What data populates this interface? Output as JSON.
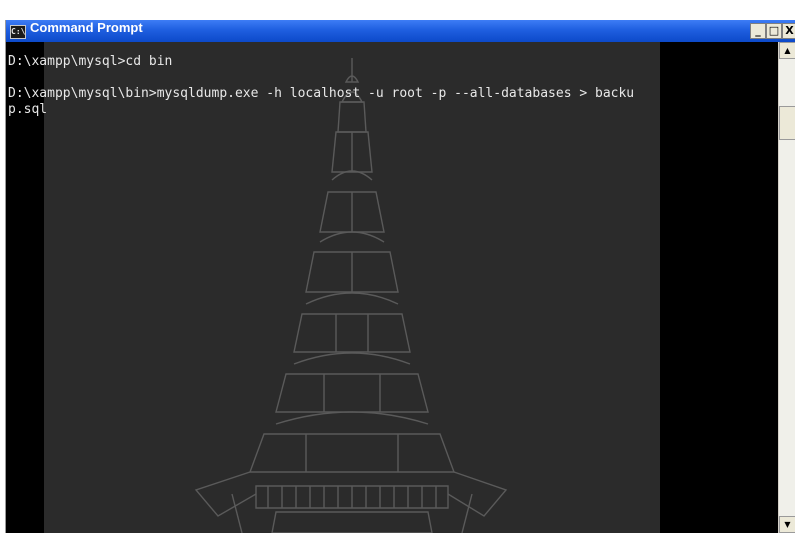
{
  "window": {
    "title": "Command Prompt",
    "icon": "console-app-icon",
    "icon_glyph": "C:\\",
    "controls": {
      "minimize": "_",
      "maximize": "□",
      "close": "X"
    }
  },
  "console": {
    "lines": [
      "D:\\xampp\\mysql>cd bin",
      "",
      "D:\\xampp\\mysql\\bin>mysqldump.exe -h localhost -u root -p --all-databases > backu",
      "p.sql"
    ],
    "text_color": "#e8e8e8",
    "background": "#000000",
    "watermark": "temple-spire-watermark"
  },
  "scrollbar": {
    "up_glyph": "▲",
    "down_glyph": "▼"
  },
  "colors": {
    "titlebar": "#0c49c9",
    "title_text": "#ffffff"
  }
}
